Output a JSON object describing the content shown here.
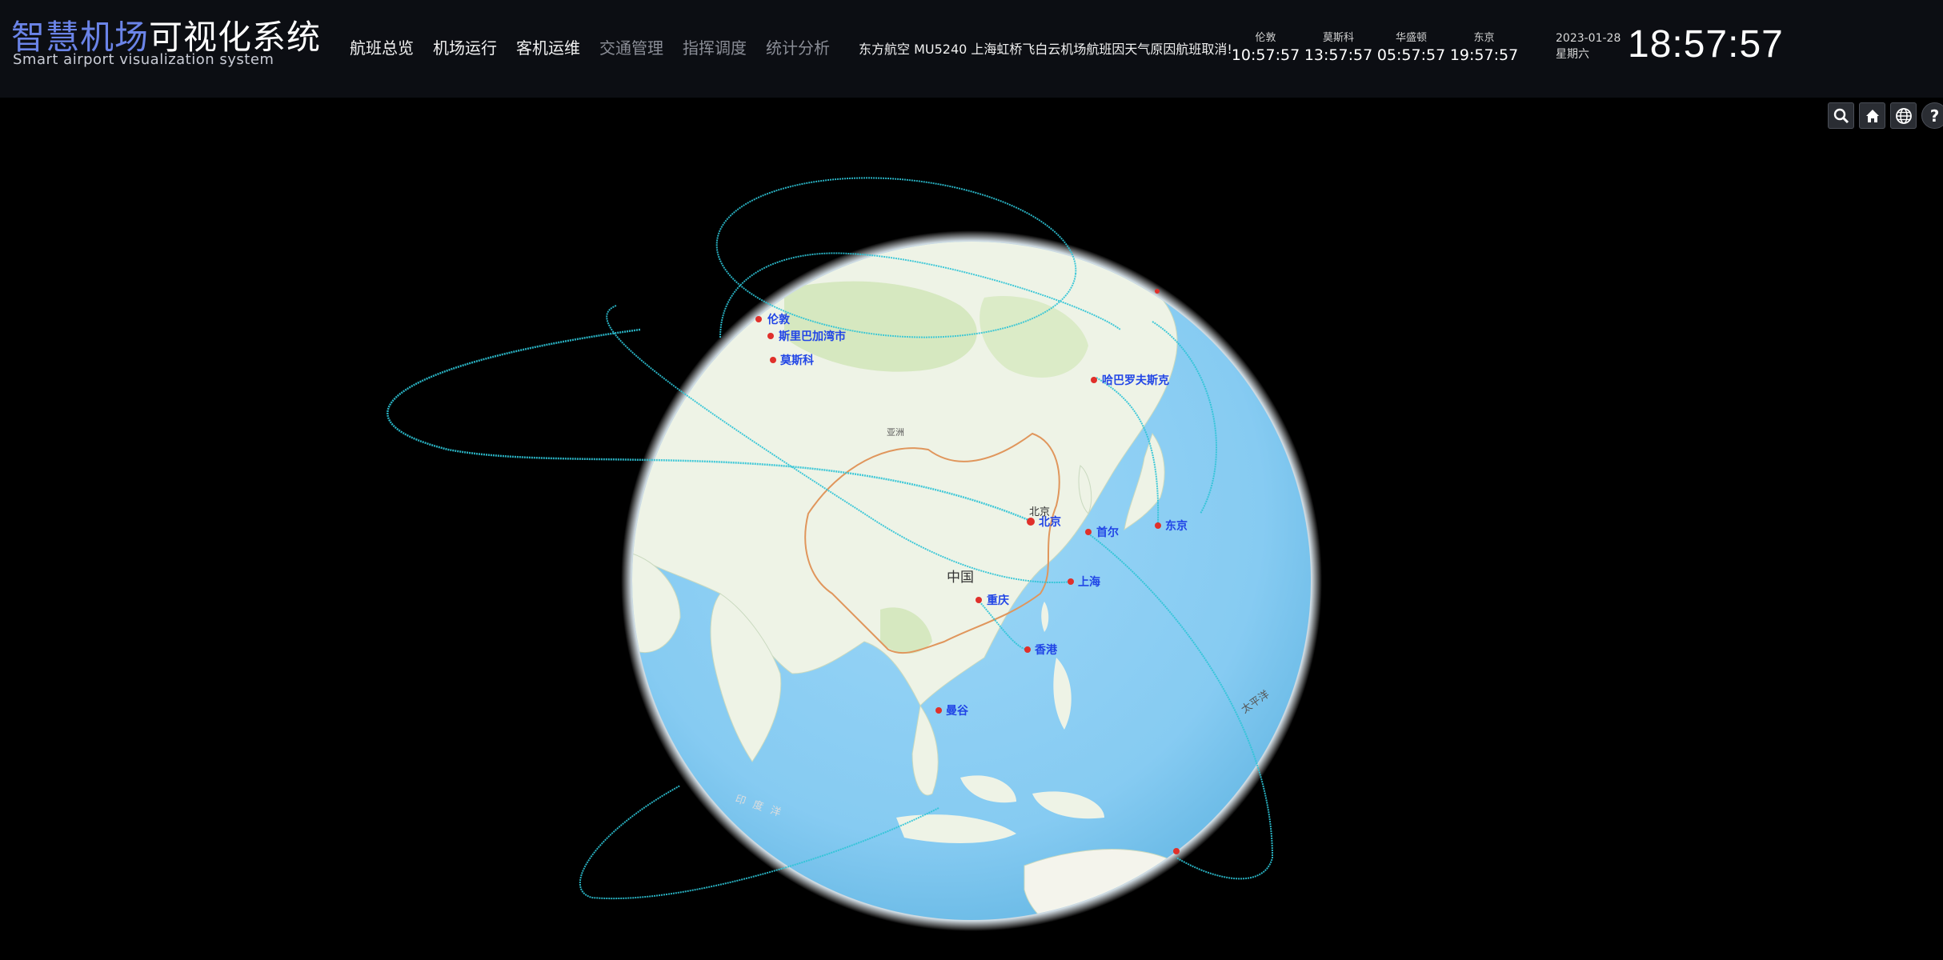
{
  "header": {
    "title_part1": "智慧机场",
    "title_part2": "可视化系统",
    "subtitle": "Smart airport visualization system",
    "nav": [
      {
        "label": "航班总览",
        "active": true
      },
      {
        "label": "机场运行",
        "active": true
      },
      {
        "label": "客机运维",
        "active": true
      },
      {
        "label": "交通管理",
        "active": false
      },
      {
        "label": "指挥调度",
        "active": false
      },
      {
        "label": "统计分析",
        "active": false
      }
    ],
    "ticker": "东方航空 MU5240 上海虹桥飞白云机场航班因天气原因航班取消!",
    "world_clocks": [
      {
        "city": "伦敦",
        "time": "10:57:57"
      },
      {
        "city": "莫斯科",
        "time": "13:57:57"
      },
      {
        "city": "华盛顿",
        "time": "05:57:57"
      },
      {
        "city": "东京",
        "time": "19:57:57"
      }
    ],
    "date": "2023-01-28",
    "weekday": "星期六",
    "current_time": "18:57:57"
  },
  "toolbar": {
    "buttons": [
      "search-icon",
      "home-icon",
      "globe-icon",
      "help-icon"
    ],
    "help_glyph": "?"
  },
  "globe": {
    "map_labels": {
      "country": "中国",
      "capital": "北京",
      "region": "亚洲",
      "ocean_pacific": "太平洋",
      "ocean_indian": "印度洋"
    },
    "cities": [
      {
        "key": "london",
        "name": "伦敦"
      },
      {
        "key": "stockholm",
        "name": "斯里巴加湾市"
      },
      {
        "key": "moscow",
        "name": "莫斯科"
      },
      {
        "key": "khabarovsk",
        "name": "哈巴罗夫斯克"
      },
      {
        "key": "beijing",
        "name": "北京"
      },
      {
        "key": "seoul",
        "name": "首尔"
      },
      {
        "key": "tokyo",
        "name": "东京"
      },
      {
        "key": "shanghai",
        "name": "上海"
      },
      {
        "key": "chongqing",
        "name": "重庆"
      },
      {
        "key": "hongkong",
        "name": "香港"
      },
      {
        "key": "bangkok",
        "name": "曼谷"
      }
    ],
    "colors": {
      "ocean": "#8fd0f4",
      "land": "#eef3e6",
      "route": "#2ec4d6",
      "dot": "#e0302a",
      "label": "#2145e6"
    }
  }
}
